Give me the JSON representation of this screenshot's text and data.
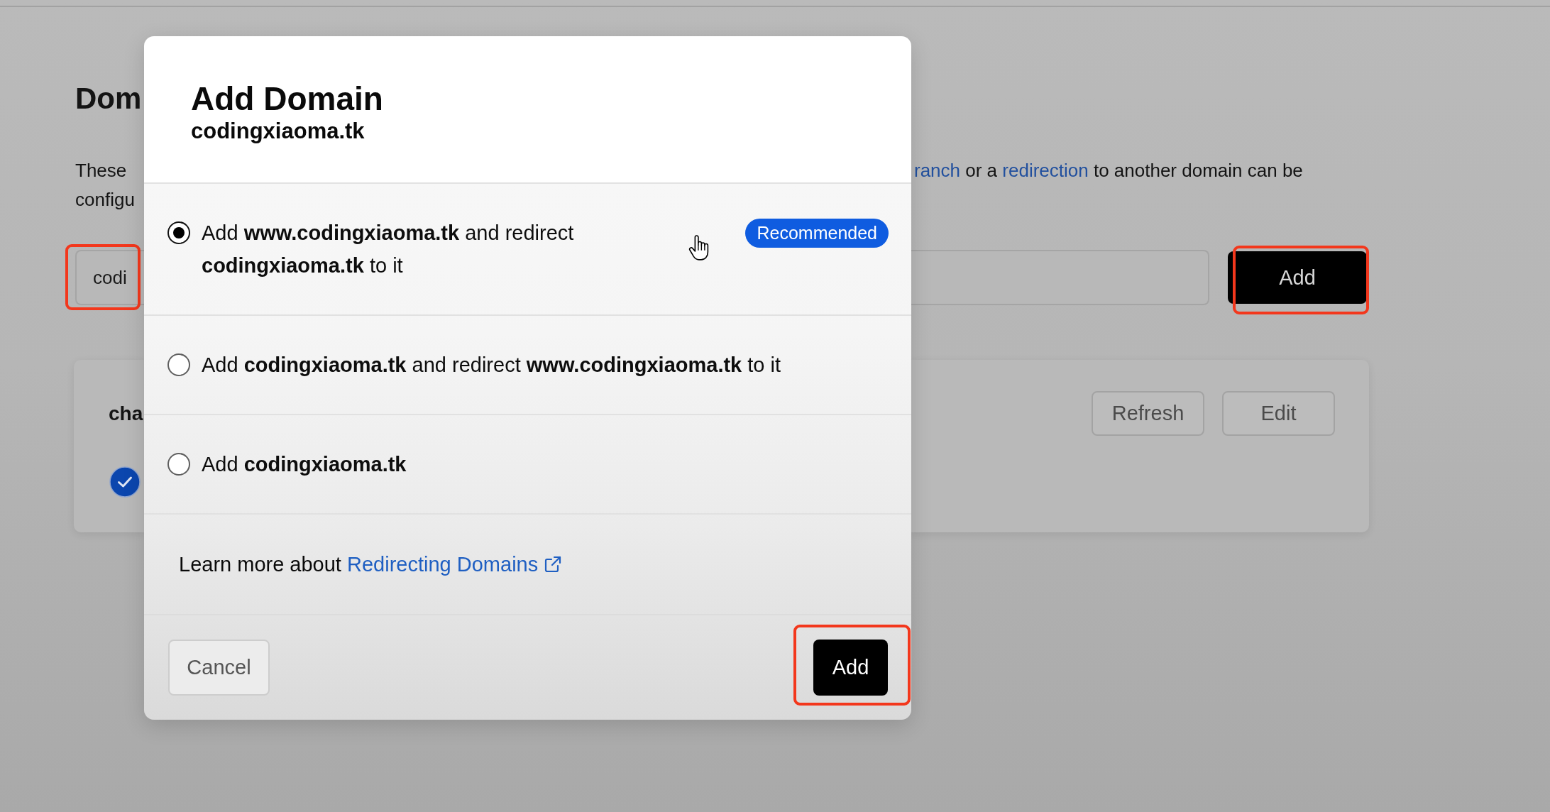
{
  "background_page": {
    "title": "Dom",
    "description_left": [
      "These",
      "configu"
    ],
    "description_right": [
      {
        "kind": "link",
        "text": "ranch"
      },
      {
        "kind": "text",
        "text": " or a "
      },
      {
        "kind": "link",
        "text": "redirection"
      },
      {
        "kind": "text",
        "text": " to another domain can be"
      }
    ],
    "domain_input": {
      "value": "codi",
      "highlighted": true
    },
    "add_button": {
      "label": "Add",
      "highlighted": true
    },
    "card": {
      "title": "cha",
      "buttons": [
        "Refresh",
        "Edit"
      ]
    }
  },
  "dialog": {
    "title": "Add Domain",
    "subtitle": "codingxiaoma.tk",
    "options": [
      {
        "text": "Add **www.codingxiaoma.tk** and redirect **codingxiaoma.tk** to it",
        "selected": true,
        "badge": "Recommended"
      },
      {
        "text": "Add **codingxiaoma.tk** and redirect **www.codingxiaoma.tk** to it",
        "selected": false
      },
      {
        "text": "Add **codingxiaoma.tk**",
        "selected": false
      }
    ],
    "learn_more": {
      "text": "Learn more about",
      "link": "Redirecting Domains"
    },
    "buttons": [
      {
        "label": "Cancel",
        "kind": "secondary",
        "highlighted": false
      },
      {
        "label": "Add",
        "kind": "primary",
        "highlighted": true
      }
    ]
  }
}
